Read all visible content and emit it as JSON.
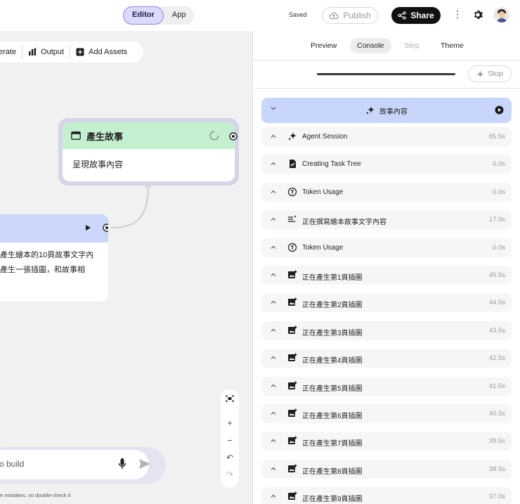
{
  "header": {
    "modes": [
      {
        "label": "Editor",
        "active": true
      },
      {
        "label": "App",
        "active": false
      }
    ],
    "saved_label": "Saved",
    "publish_label": "Publish",
    "share_label": "Share"
  },
  "canvas": {
    "toolbar": {
      "generate_label": "erate",
      "output_label": "Output",
      "add_assets_label": "Add Assets"
    },
    "node_story": {
      "title": "產生故事",
      "body": "呈現故事內容"
    },
    "node_left": {
      "body_line1": "產生繪本的10頁故事文字內",
      "body_line2": "產生一張插圖，和故事相"
    },
    "prompt": {
      "placeholder": "o build"
    },
    "disclaimer": "e mistakes, so double-check it"
  },
  "panel": {
    "tabs": [
      {
        "label": "Preview",
        "state": "normal"
      },
      {
        "label": "Console",
        "state": "active"
      },
      {
        "label": "Step",
        "state": "disabled"
      },
      {
        "label": "Theme",
        "state": "normal"
      }
    ],
    "progress": 1.0,
    "stop_label": "Stop",
    "main_row": {
      "label": "故事內容"
    },
    "rows": [
      {
        "icon": "sparkle-icon",
        "label": "Agent Session",
        "duration": "85.5s"
      },
      {
        "icon": "task-check-icon",
        "label": "Creating Task Tree",
        "duration": "0.0s"
      },
      {
        "icon": "token-icon",
        "label": "Token Usage",
        "duration": "0.0s"
      },
      {
        "icon": "text-sparkle-icon",
        "label": "正在撰寫繪本故事文字內容",
        "duration": "17.0s"
      },
      {
        "icon": "token-icon",
        "label": "Token Usage",
        "duration": "0.0s"
      },
      {
        "icon": "image-add-icon",
        "label": "正在產生第1頁插圖",
        "duration": "45.5s"
      },
      {
        "icon": "image-add-icon",
        "label": "正在產生第2頁插圖",
        "duration": "44.5s"
      },
      {
        "icon": "image-add-icon",
        "label": "正在產生第3頁插圖",
        "duration": "43.5s"
      },
      {
        "icon": "image-add-icon",
        "label": "正在產生第4頁插圖",
        "duration": "42.5s"
      },
      {
        "icon": "image-add-icon",
        "label": "正在產生第5頁插圖",
        "duration": "41.5s"
      },
      {
        "icon": "image-add-icon",
        "label": "正在產生第6頁插圖",
        "duration": "40.5s"
      },
      {
        "icon": "image-add-icon",
        "label": "正在產生第7頁插圖",
        "duration": "39.5s"
      },
      {
        "icon": "image-add-icon",
        "label": "正在產生第8頁插圖",
        "duration": "38.5s"
      },
      {
        "icon": "image-add-icon",
        "label": "正在產生第9頁插圖",
        "duration": "37.0s"
      }
    ]
  },
  "colors": {
    "accent_mode": "#dcdafa",
    "node_green": "#c4f0cf",
    "node_blue": "#cad7fb",
    "main_row": "#c9d6fb"
  }
}
